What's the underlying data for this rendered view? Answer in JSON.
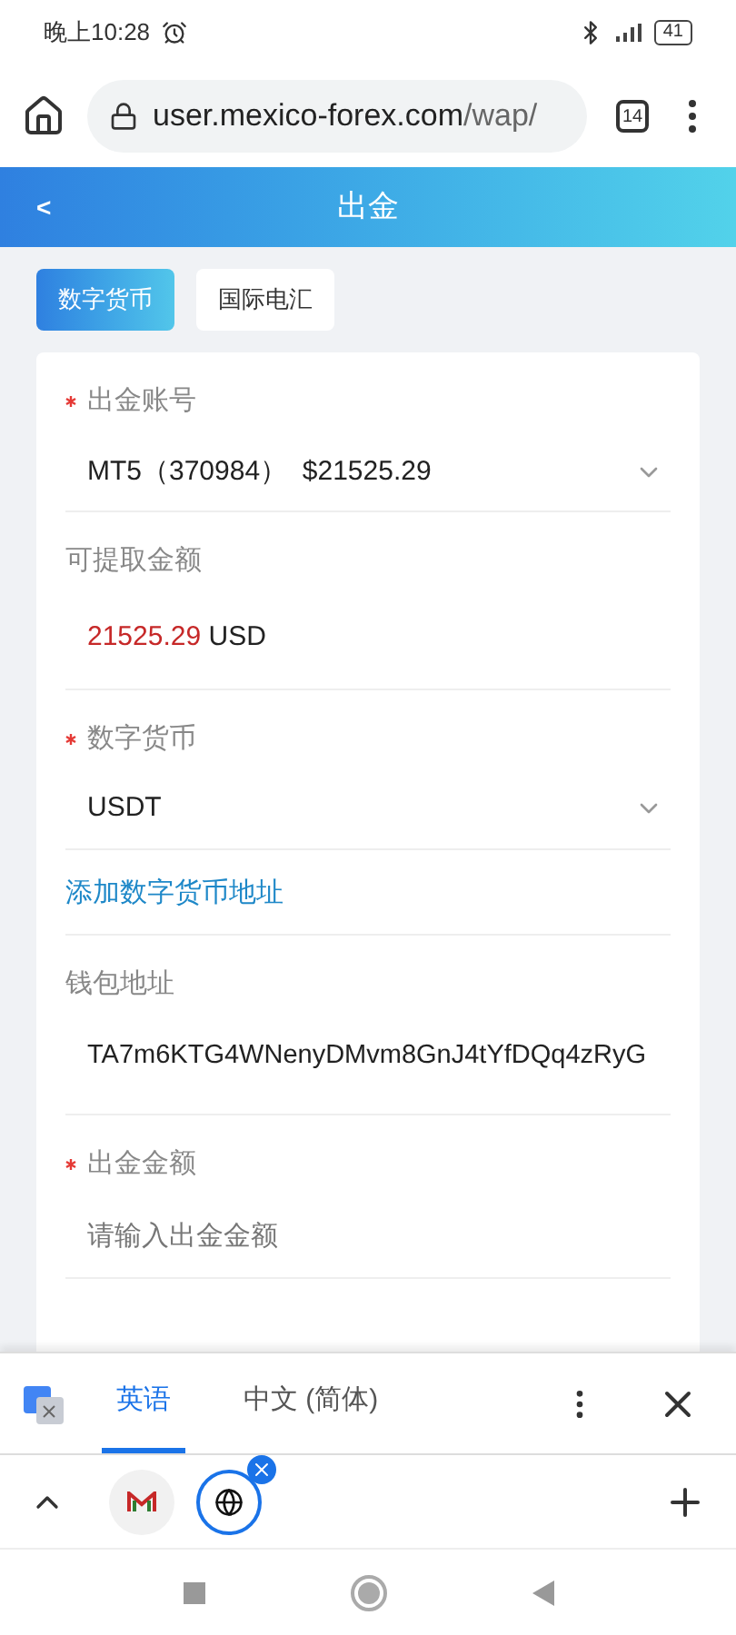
{
  "status_bar": {
    "time": "晚上10:28",
    "battery": "41"
  },
  "browser": {
    "url_host": "user.mexico-forex.com",
    "url_path": "/wap/",
    "tab_count": "14"
  },
  "header": {
    "back": "<",
    "title": "出金"
  },
  "method_tabs": [
    {
      "label": "数字货币",
      "selected": true
    },
    {
      "label": "国际电汇",
      "selected": false
    }
  ],
  "form": [
    {
      "kind": "select",
      "label": "出金账号",
      "required": true,
      "value": "MT5（370984）  $21525.29"
    },
    {
      "kind": "amount",
      "label": "可提取金额",
      "required": false,
      "amount": "21525.29",
      "currency": "USD"
    },
    {
      "kind": "select",
      "label": "数字货币",
      "required": true,
      "value": "USDT",
      "link": "添加数字货币地址"
    },
    {
      "kind": "text",
      "label": "钱包地址",
      "required": false,
      "value": "TA7m6KTG4WNenyDMvm8GnJ4tYfDQq4zRyG"
    },
    {
      "kind": "input",
      "label": "出金金额",
      "required": true,
      "placeholder": "请输入出金金额"
    }
  ],
  "translate_bar": {
    "languages": [
      {
        "label": "英语",
        "selected": true
      },
      {
        "label": "中文 (简体)",
        "selected": false
      }
    ]
  },
  "tab_strip": {
    "tabs": [
      {
        "kind": "mail",
        "selected": false
      },
      {
        "kind": "globe",
        "selected": true
      }
    ]
  }
}
